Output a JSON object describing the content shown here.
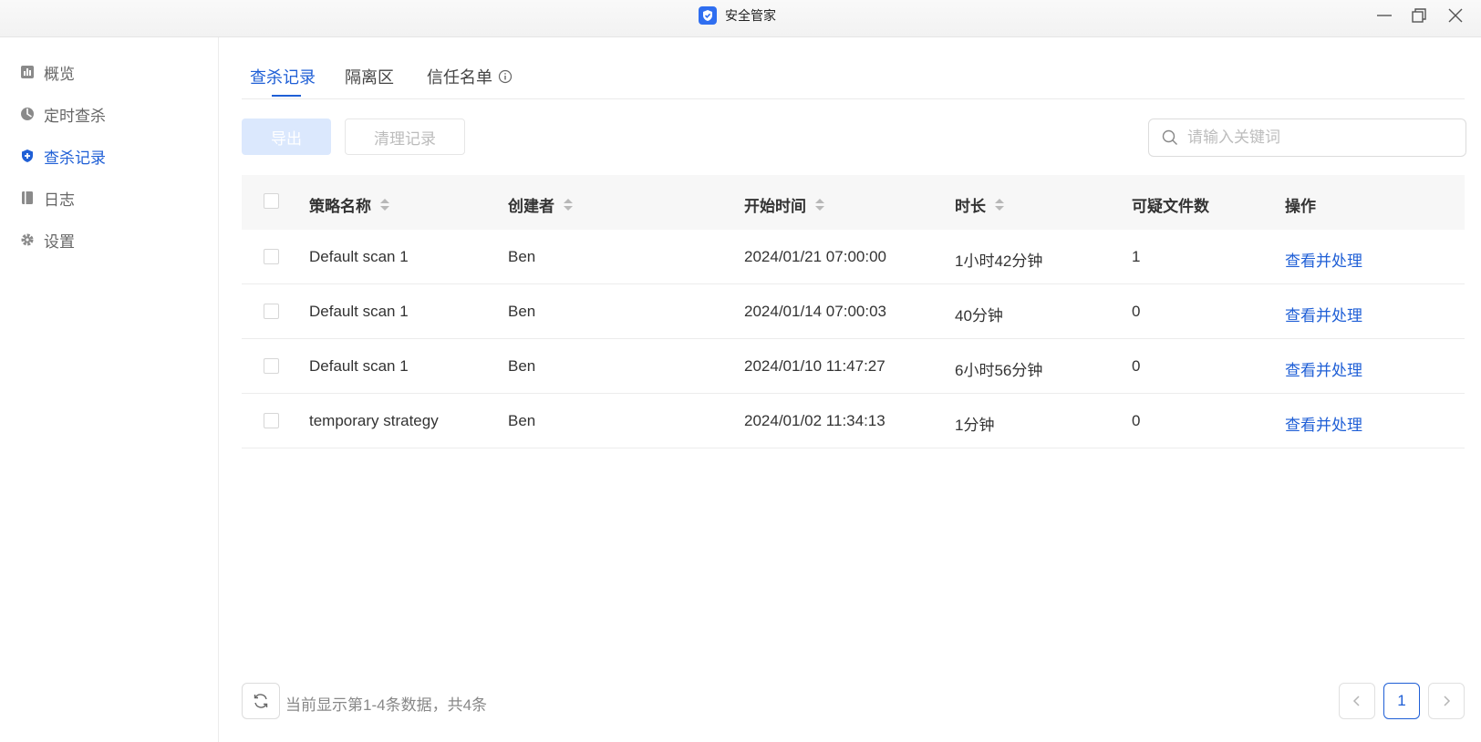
{
  "window": {
    "title": "安全管家"
  },
  "sidebar": {
    "items": [
      {
        "label": "概览",
        "icon": "chart-icon"
      },
      {
        "label": "定时查杀",
        "icon": "clock-pie-icon"
      },
      {
        "label": "查杀记录",
        "icon": "shield-icon",
        "active": true
      },
      {
        "label": "日志",
        "icon": "book-icon"
      },
      {
        "label": "设置",
        "icon": "gear-icon"
      }
    ]
  },
  "tabs": [
    {
      "label": "查杀记录",
      "active": true
    },
    {
      "label": "隔离区"
    },
    {
      "label": "信任名单"
    }
  ],
  "toolbar": {
    "export_label": "导出",
    "clear_label": "清理记录",
    "search_placeholder": "请输入关键词"
  },
  "table": {
    "headers": {
      "name": "策略名称",
      "creator": "创建者",
      "start_time": "开始时间",
      "duration": "时长",
      "suspicious": "可疑文件数",
      "action": "操作"
    },
    "rows": [
      {
        "name": "Default scan 1",
        "creator": "Ben",
        "start_time": "2024/01/21 07:00:00",
        "duration": "1小时42分钟",
        "suspicious": "1",
        "action": "查看并处理"
      },
      {
        "name": "Default scan 1",
        "creator": "Ben",
        "start_time": "2024/01/14 07:00:03",
        "duration": "40分钟",
        "suspicious": "0",
        "action": "查看并处理"
      },
      {
        "name": "Default scan 1",
        "creator": "Ben",
        "start_time": "2024/01/10 11:47:27",
        "duration": "6小时56分钟",
        "suspicious": "0",
        "action": "查看并处理"
      },
      {
        "name": "temporary strategy",
        "creator": "Ben",
        "start_time": "2024/01/02 11:34:13",
        "duration": "1分钟",
        "suspicious": "0",
        "action": "查看并处理"
      }
    ]
  },
  "footer": {
    "info": "当前显示第1-4条数据，共4条",
    "current_page": "1"
  },
  "colors": {
    "accent": "#1f5fd6",
    "export_disabled_bg": "#dbe8fd"
  }
}
